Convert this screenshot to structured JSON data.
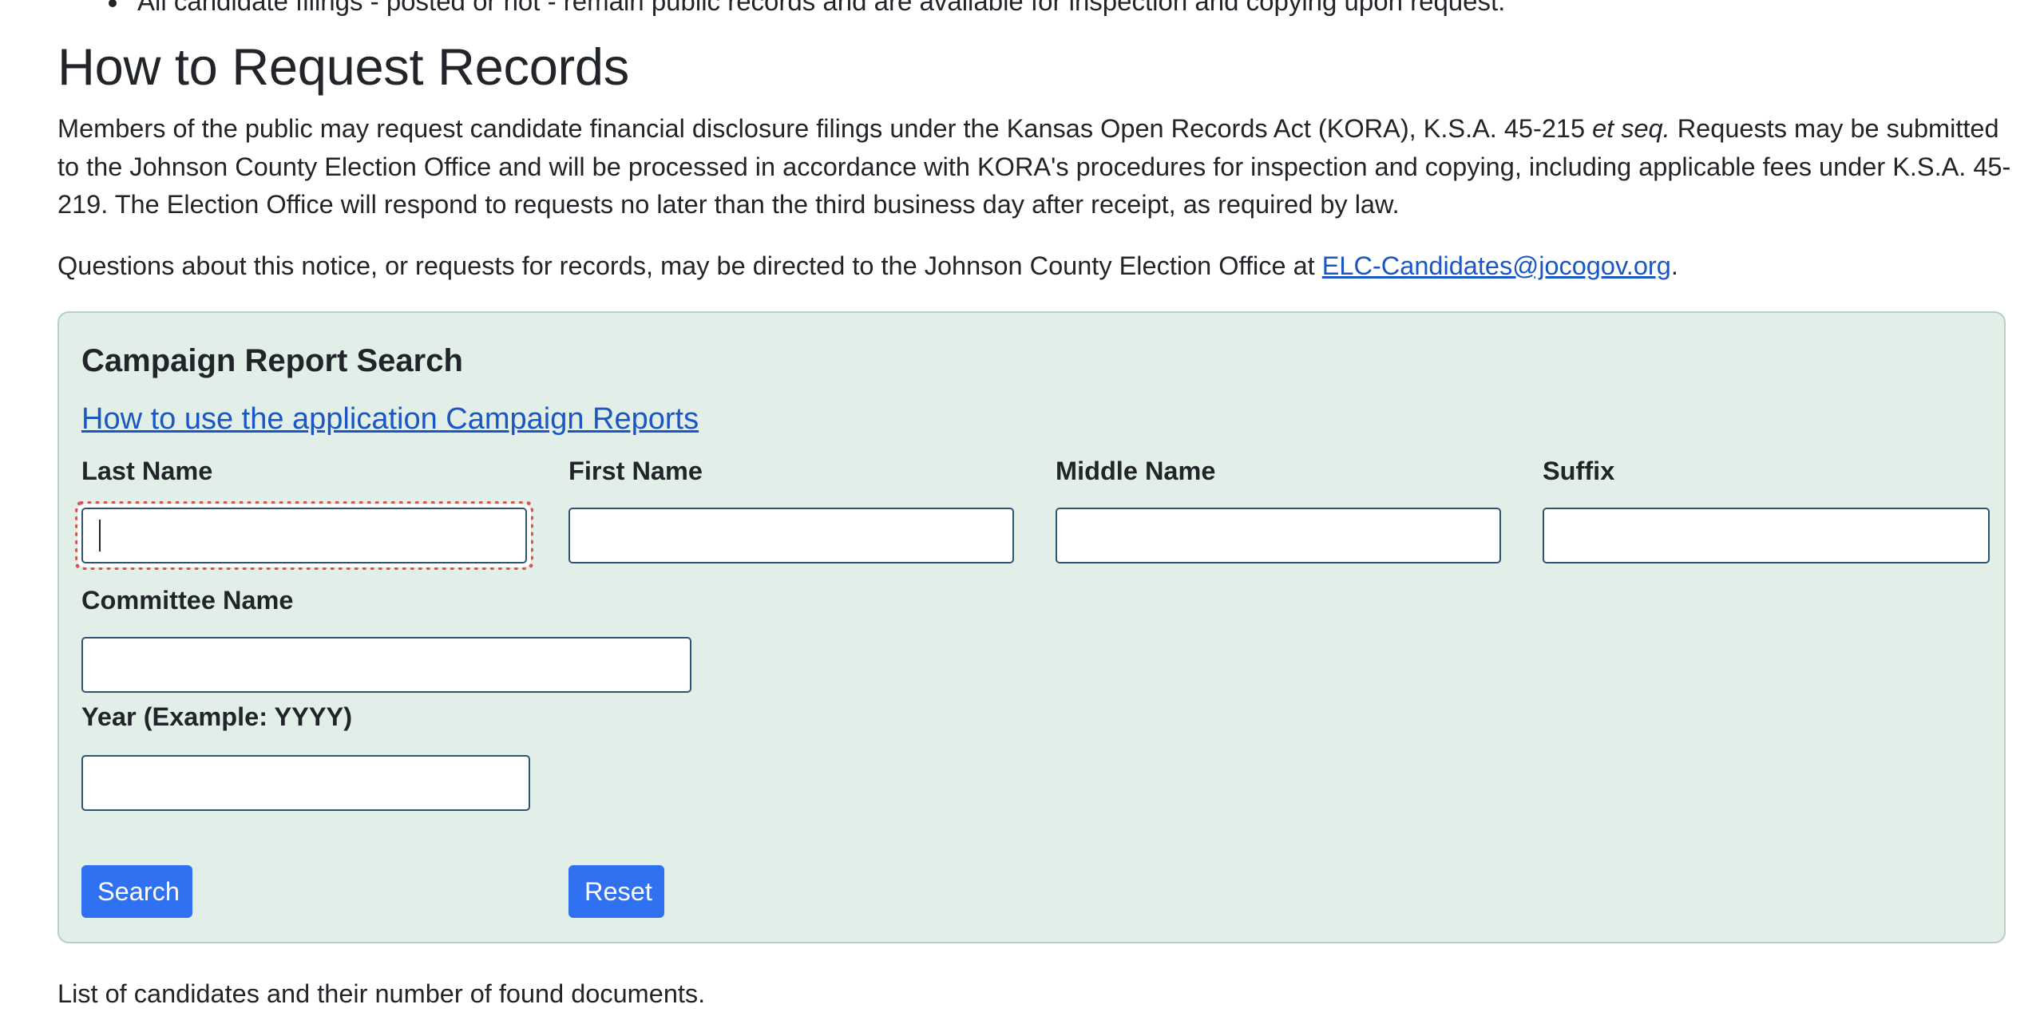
{
  "top_partial_line": "All candidate filings - posted or not - remain public records and are available for inspection and copying upon request.",
  "heading": "How to Request Records",
  "request_paragraph": {
    "part1": "Members of the public may request candidate financial disclosure filings under the Kansas Open Records Act (KORA), K.S.A. 45-215 ",
    "italic": "et seq.",
    "part2": " Requests may be submitted to the Johnson County Election Office and will be processed in accordance with KORA's procedures for inspection and copying, including applicable fees under K.S.A. 45-219. The Election Office will respond to requests no later than the third business day after receipt, as required by law."
  },
  "contact_paragraph": {
    "text": "Questions about this notice, or requests for records, may be directed to the Johnson County Election Office at ",
    "email": "ELC-Candidates@jocogov.org",
    "after": "."
  },
  "search_panel": {
    "title": "Campaign Report Search",
    "help_link": "How to use the application Campaign Reports",
    "fields": {
      "last_name": {
        "label": "Last Name",
        "value": ""
      },
      "first_name": {
        "label": "First Name",
        "value": ""
      },
      "middle_name": {
        "label": "Middle Name",
        "value": ""
      },
      "suffix": {
        "label": "Suffix",
        "value": ""
      },
      "committee_name": {
        "label": "Committee Name",
        "value": ""
      },
      "year": {
        "label": "Year (Example: YYYY)",
        "value": ""
      }
    },
    "search_button": "Search",
    "reset_button": "Reset"
  },
  "results_caption": "List of candidates and their number of found documents.",
  "colors": {
    "panel_bg": "#e2efe8",
    "button_bg": "#3071f2",
    "link": "#1a56c4",
    "focus_ring": "#d9534f"
  }
}
